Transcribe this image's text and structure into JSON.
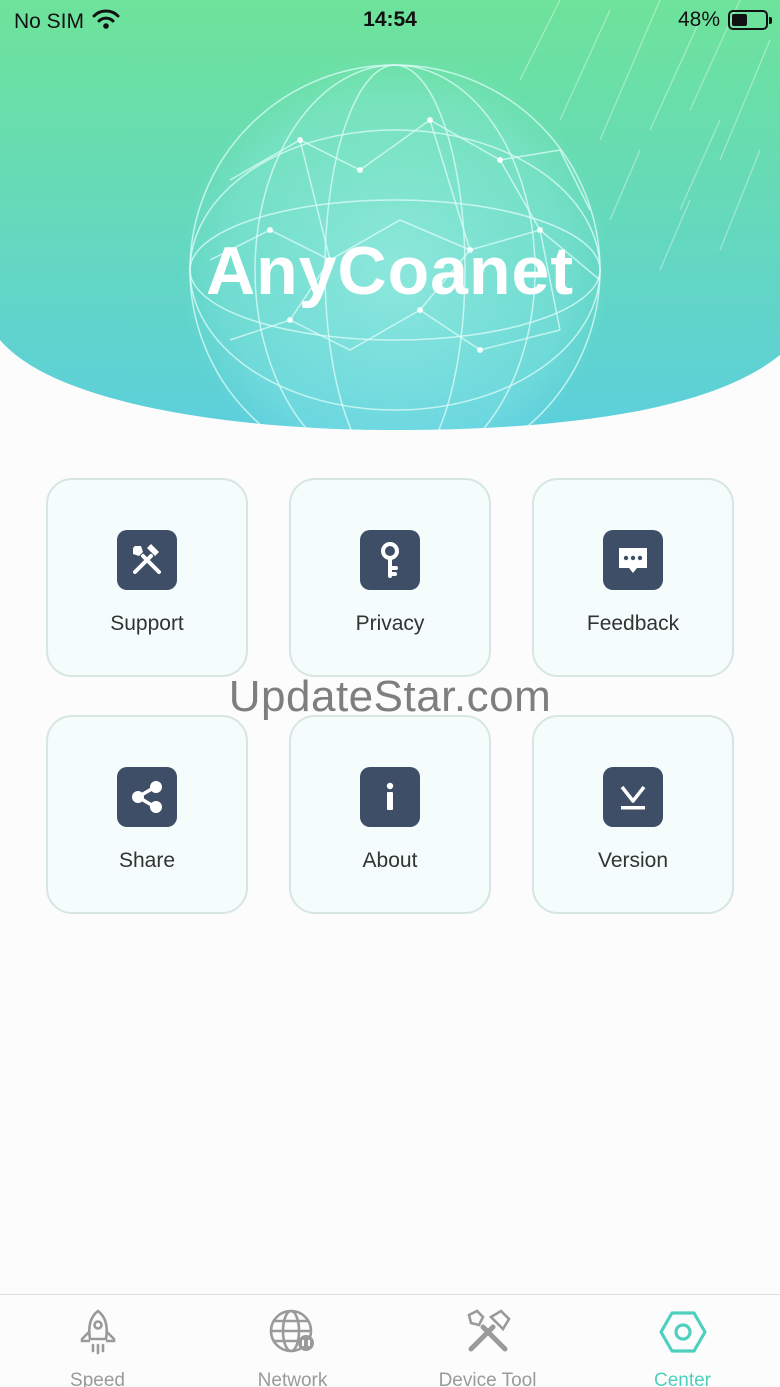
{
  "status_bar": {
    "carrier": "No SIM",
    "time": "14:54",
    "battery": "48%",
    "battery_level": 0.48
  },
  "header": {
    "title": "AnyCoanet"
  },
  "menu": {
    "items": [
      {
        "label": "Support",
        "icon": "tools-icon"
      },
      {
        "label": "Privacy",
        "icon": "key-icon"
      },
      {
        "label": "Feedback",
        "icon": "chat-bubble-icon"
      },
      {
        "label": "Share",
        "icon": "share-icon"
      },
      {
        "label": "About",
        "icon": "info-icon"
      },
      {
        "label": "Version",
        "icon": "download-icon"
      }
    ]
  },
  "watermark": "UpdateStar.com",
  "tabbar": {
    "tabs": [
      {
        "label": "Speed",
        "icon": "rocket-icon",
        "active": false
      },
      {
        "label": "Network",
        "icon": "globe-icon",
        "active": false
      },
      {
        "label": "Device Tool",
        "icon": "tools-icon",
        "active": false
      },
      {
        "label": "Center",
        "icon": "hexagon-icon",
        "active": true
      }
    ]
  },
  "colors": {
    "header_gradient_top": "#6ee39a",
    "header_gradient_bottom": "#5ccfdc",
    "tile_icon_bg": "#3e4e66",
    "active_tab": "#4fd0bf",
    "inactive_tab": "#9a9a9a"
  }
}
